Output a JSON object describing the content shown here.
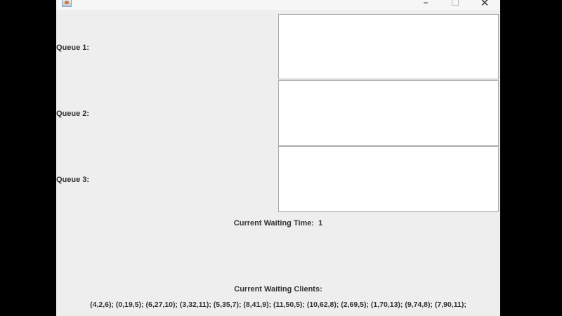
{
  "window": {
    "title": "",
    "controls": {
      "minimize": "–",
      "maximize": "☐",
      "close": "✕"
    }
  },
  "queues": [
    {
      "label": "Queue 1:",
      "contents": ""
    },
    {
      "label": "Queue 2:",
      "contents": ""
    },
    {
      "label": "Queue 3:",
      "contents": ""
    }
  ],
  "waiting_time": {
    "label": "Current Waiting Time:",
    "value": "1"
  },
  "waiting_clients": {
    "label": "Current Waiting Clients:",
    "list": "(4,2,6); (0,19,5); (6,27,10); (3,32,11); (5,35,7); (8,41,9); (11,50,5); (10,62,8); (2,69,5); (1,70,13); (9,74,8); (7,90,11);"
  },
  "colors": {
    "window_background": "#eeeeee",
    "outer_background": "#000000",
    "text": "#333333",
    "queue_box": "#ffffff",
    "queue_border": "#aaaaaa"
  },
  "icons": {
    "app": "java-app-icon",
    "minimize": "minimize-icon",
    "maximize": "maximize-icon",
    "close": "close-icon"
  }
}
